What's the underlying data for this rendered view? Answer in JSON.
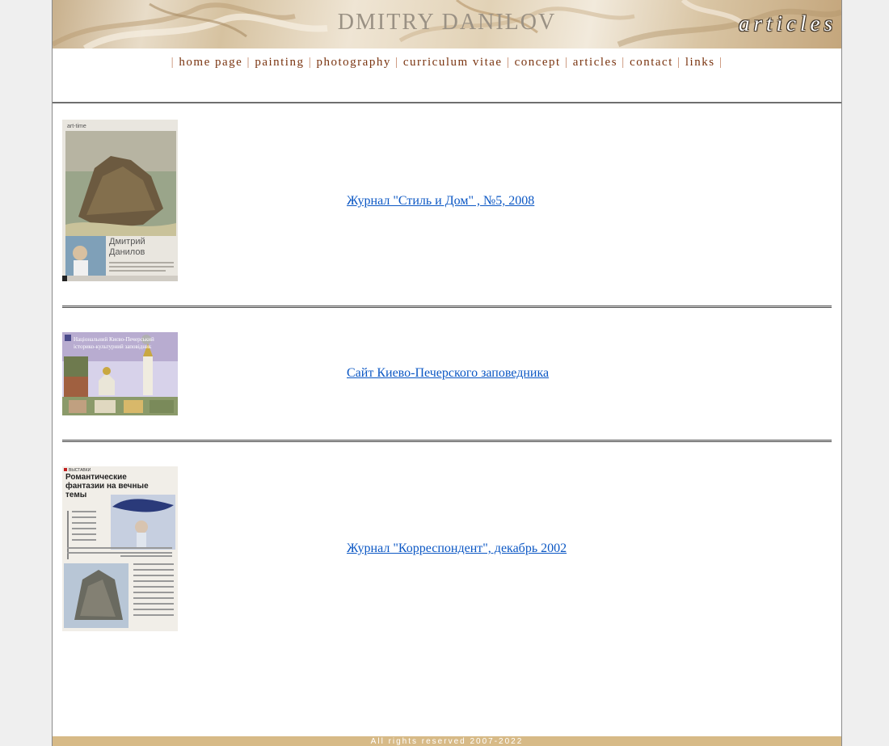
{
  "header": {
    "site_title": "DMITRY DANILOV",
    "section_label": "articles"
  },
  "nav": {
    "items": [
      {
        "label": "home page"
      },
      {
        "label": "painting"
      },
      {
        "label": "photography"
      },
      {
        "label": "curriculum vitae"
      },
      {
        "label": "concept"
      },
      {
        "label": "articles"
      },
      {
        "label": "contact"
      },
      {
        "label": "links"
      }
    ],
    "separator": "|"
  },
  "articles": [
    {
      "link_text": "Журнал \"Стиль и Дом\" , №5, 2008",
      "thumb": {
        "header": "art-time",
        "name_line1": "Дмитрий",
        "name_line2": "Данилов"
      }
    },
    {
      "link_text": "Сайт Киево-Печерского заповедника",
      "thumb": {
        "banner_line1": "Національний Києво-Печерський",
        "banner_line2": "історико-культурний заповідник"
      }
    },
    {
      "link_text": "Журнал \"Корреспондент\", декабрь 2002",
      "thumb": {
        "tag": "ВЫСТАВКИ",
        "headline_line1": "Романтические",
        "headline_line2": "фантазии на вечные",
        "headline_line3": "темы"
      }
    }
  ],
  "footer": {
    "text": "All rights reserved 2007-2022"
  }
}
